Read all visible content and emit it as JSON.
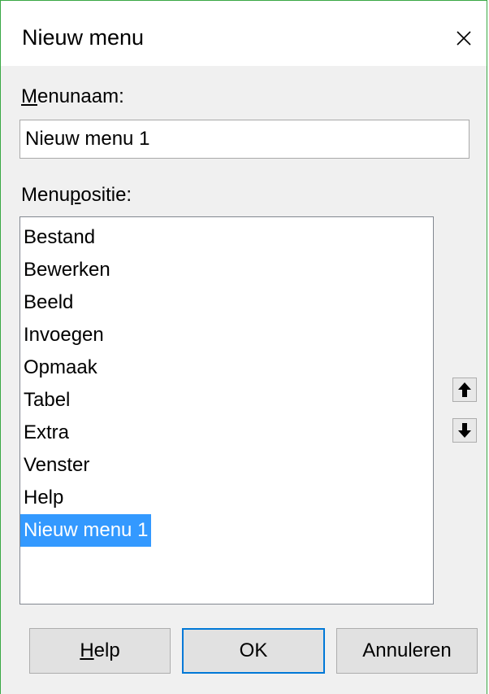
{
  "dialog": {
    "title": "Nieuw menu",
    "close_icon": "close-icon"
  },
  "name_field": {
    "label_mnemonic": "M",
    "label_rest": "enunaam:",
    "value": "Nieuw menu 1"
  },
  "position_field": {
    "label_before": "Menu",
    "label_mnemonic": "p",
    "label_after": "ositie:",
    "items": [
      {
        "label": "Bestand",
        "selected": false
      },
      {
        "label": "Bewerken",
        "selected": false
      },
      {
        "label": "Beeld",
        "selected": false
      },
      {
        "label": "Invoegen",
        "selected": false
      },
      {
        "label": "Opmaak",
        "selected": false
      },
      {
        "label": "Tabel",
        "selected": false
      },
      {
        "label": "Extra",
        "selected": false
      },
      {
        "label": "Venster",
        "selected": false
      },
      {
        "label": "Help",
        "selected": false
      },
      {
        "label": "Nieuw menu 1",
        "selected": true
      }
    ],
    "move_up_icon": "arrow-up-icon",
    "move_down_icon": "arrow-down-icon"
  },
  "buttons": {
    "help_mnemonic": "H",
    "help_rest": "elp",
    "ok": "OK",
    "cancel": "Annuleren"
  },
  "colors": {
    "selection": "#3399ff",
    "default_button_border": "#0078d7",
    "window_border": "#3aa845"
  }
}
